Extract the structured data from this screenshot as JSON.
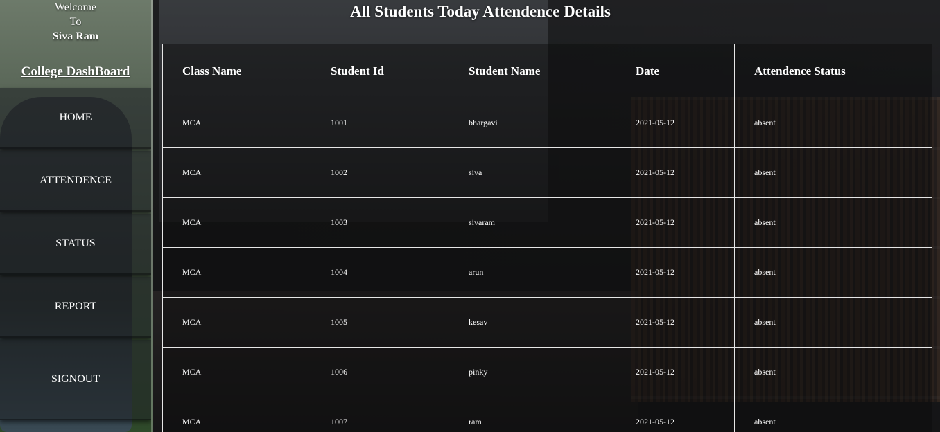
{
  "sidebar": {
    "welcome_line1": "Welcome",
    "welcome_line2": "To",
    "user_name": "Siva Ram",
    "dashboard_title": "College DashBoard",
    "nav": [
      {
        "label": "HOME"
      },
      {
        "label": "ATTENDENCE"
      },
      {
        "label": "STATUS"
      },
      {
        "label": "REPORT"
      },
      {
        "label": "SIGNOUT"
      }
    ]
  },
  "main": {
    "title": "All Students Today Attendence Details",
    "table": {
      "headers": [
        "Class Name",
        "Student Id",
        "Student Name",
        "Date",
        "Attendence Status"
      ],
      "rows": [
        [
          "MCA",
          "1001",
          "bhargavi",
          "2021-05-12",
          "absent"
        ],
        [
          "MCA",
          "1002",
          "siva",
          "2021-05-12",
          "absent"
        ],
        [
          "MCA",
          "1003",
          "sivaram",
          "2021-05-12",
          "absent"
        ],
        [
          "MCA",
          "1004",
          "arun",
          "2021-05-12",
          "absent"
        ],
        [
          "MCA",
          "1005",
          "kesav",
          "2021-05-12",
          "absent"
        ],
        [
          "MCA",
          "1006",
          "pinky",
          "2021-05-12",
          "absent"
        ],
        [
          "MCA",
          "1007",
          "ram",
          "2021-05-12",
          "absent"
        ]
      ]
    }
  }
}
